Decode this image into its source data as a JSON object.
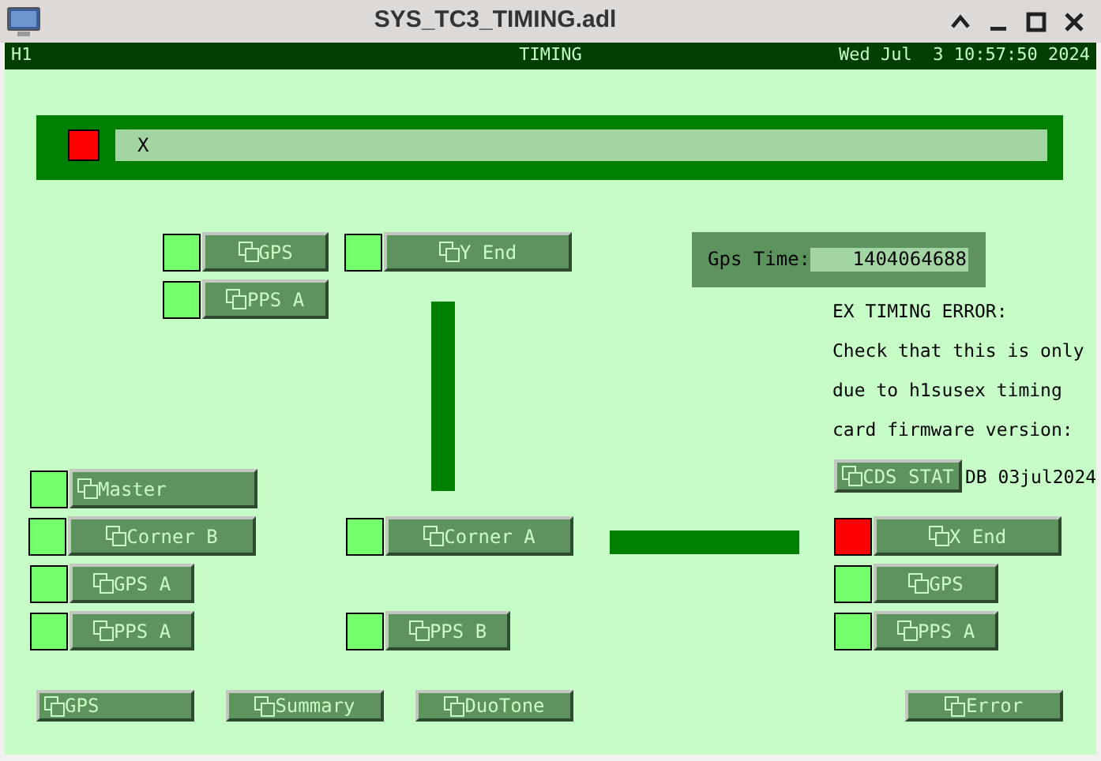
{
  "window": {
    "title": "SYS_TC3_TIMING.adl"
  },
  "header": {
    "site": "H1",
    "title": "TIMING",
    "datetime": "Wed Jul  3 10:57:50 2024"
  },
  "banner": {
    "alarm": true,
    "text": "X"
  },
  "gps_time": {
    "label": "Gps Time:",
    "value": "1404064688"
  },
  "message": [
    "EX TIMING ERROR:",
    "Check that this is only",
    "due to h1susex timing",
    "card firmware version:"
  ],
  "cds_button": {
    "label": "CDS STAT"
  },
  "db_note": "DB 03jul2024",
  "status_buttons": [
    {
      "label": "GPS",
      "alarm": false
    },
    {
      "label": "Y End",
      "alarm": false
    },
    {
      "label": "PPS A",
      "alarm": false
    },
    {
      "label": "Master",
      "alarm": false
    },
    {
      "label": "Corner B",
      "alarm": false
    },
    {
      "label": "Corner A",
      "alarm": false
    },
    {
      "label": "X End",
      "alarm": true
    },
    {
      "label": "GPS A",
      "alarm": false
    },
    {
      "label": "GPS",
      "alarm": false
    },
    {
      "label": "PPS A",
      "alarm": false
    },
    {
      "label": "PPS B",
      "alarm": false
    },
    {
      "label": "PPS A",
      "alarm": false
    }
  ],
  "links": [
    {
      "label": "GPS"
    },
    {
      "label": "Summary"
    },
    {
      "label": "DuoTone"
    },
    {
      "label": "Error"
    }
  ]
}
